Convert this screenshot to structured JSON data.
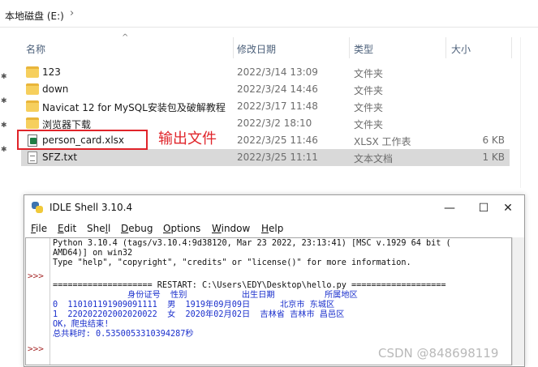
{
  "explorer": {
    "breadcrumb": "本地磁盘 (E:)",
    "columns": {
      "name": "名称",
      "date": "修改日期",
      "type": "类型",
      "size": "大小"
    },
    "files": [
      {
        "name": "123",
        "date": "2022/3/14 13:09",
        "type": "文件夹",
        "size": "",
        "icon": "folder-icon"
      },
      {
        "name": "down",
        "date": "2022/3/24 14:46",
        "type": "文件夹",
        "size": "",
        "icon": "folder-icon"
      },
      {
        "name": "Navicat 12 for MySQL安装包及破解教程",
        "date": "2022/3/17 11:48",
        "type": "文件夹",
        "size": "",
        "icon": "folder-icon"
      },
      {
        "name": "浏览器下载",
        "date": "2022/3/2 18:10",
        "type": "文件夹",
        "size": "",
        "icon": "folder-icon"
      },
      {
        "name": "person_card.xlsx",
        "date": "2022/3/25 11:46",
        "type": "XLSX 工作表",
        "size": "6 KB",
        "icon": "xlsx-file-icon"
      },
      {
        "name": "SFZ.txt",
        "date": "2022/3/25 11:11",
        "type": "文本文档",
        "size": "1 KB",
        "icon": "txt-file-icon"
      }
    ],
    "annotation": "输出文件",
    "annotation_color": "#e0242a"
  },
  "idle": {
    "title": "IDLE Shell 3.10.4",
    "buttons": {
      "minimize": "—",
      "maximize": "☐",
      "close": "✕"
    },
    "menus": [
      {
        "pre": "",
        "u": "F",
        "post": "ile"
      },
      {
        "pre": "",
        "u": "E",
        "post": "dit"
      },
      {
        "pre": "She",
        "u": "l",
        "post": "l"
      },
      {
        "pre": "",
        "u": "D",
        "post": "ebug"
      },
      {
        "pre": "",
        "u": "O",
        "post": "ptions"
      },
      {
        "pre": "",
        "u": "W",
        "post": "indow"
      },
      {
        "pre": "",
        "u": "H",
        "post": "elp"
      }
    ],
    "prompt": ">>>",
    "lines": {
      "banner1": "Python 3.10.4 (tags/v3.10.4:9d38120, Mar 23 2022, 23:13:41) [MSC v.1929 64 bit (",
      "banner2": "AMD64)] on win32",
      "banner3": "Type \"help\", \"copyright\", \"credits\" or \"license()\" for more information.",
      "restart": "==================== RESTART: C:\\Users\\EDY\\Desktop\\hello.py ===================",
      "header": "               身份证号  性别           出生日期          所属地区",
      "row0": "0  110101191909091111  男  1919年09月09日      北京市 东城区",
      "row1": "1  220202202002020022  女  2020年02月02日  吉林省 吉林市 昌邑区",
      "done": "OK，爬虫结束!",
      "time": "总共耗时: 0.5350053310394287秒"
    }
  },
  "watermark": "CSDN @848698119"
}
